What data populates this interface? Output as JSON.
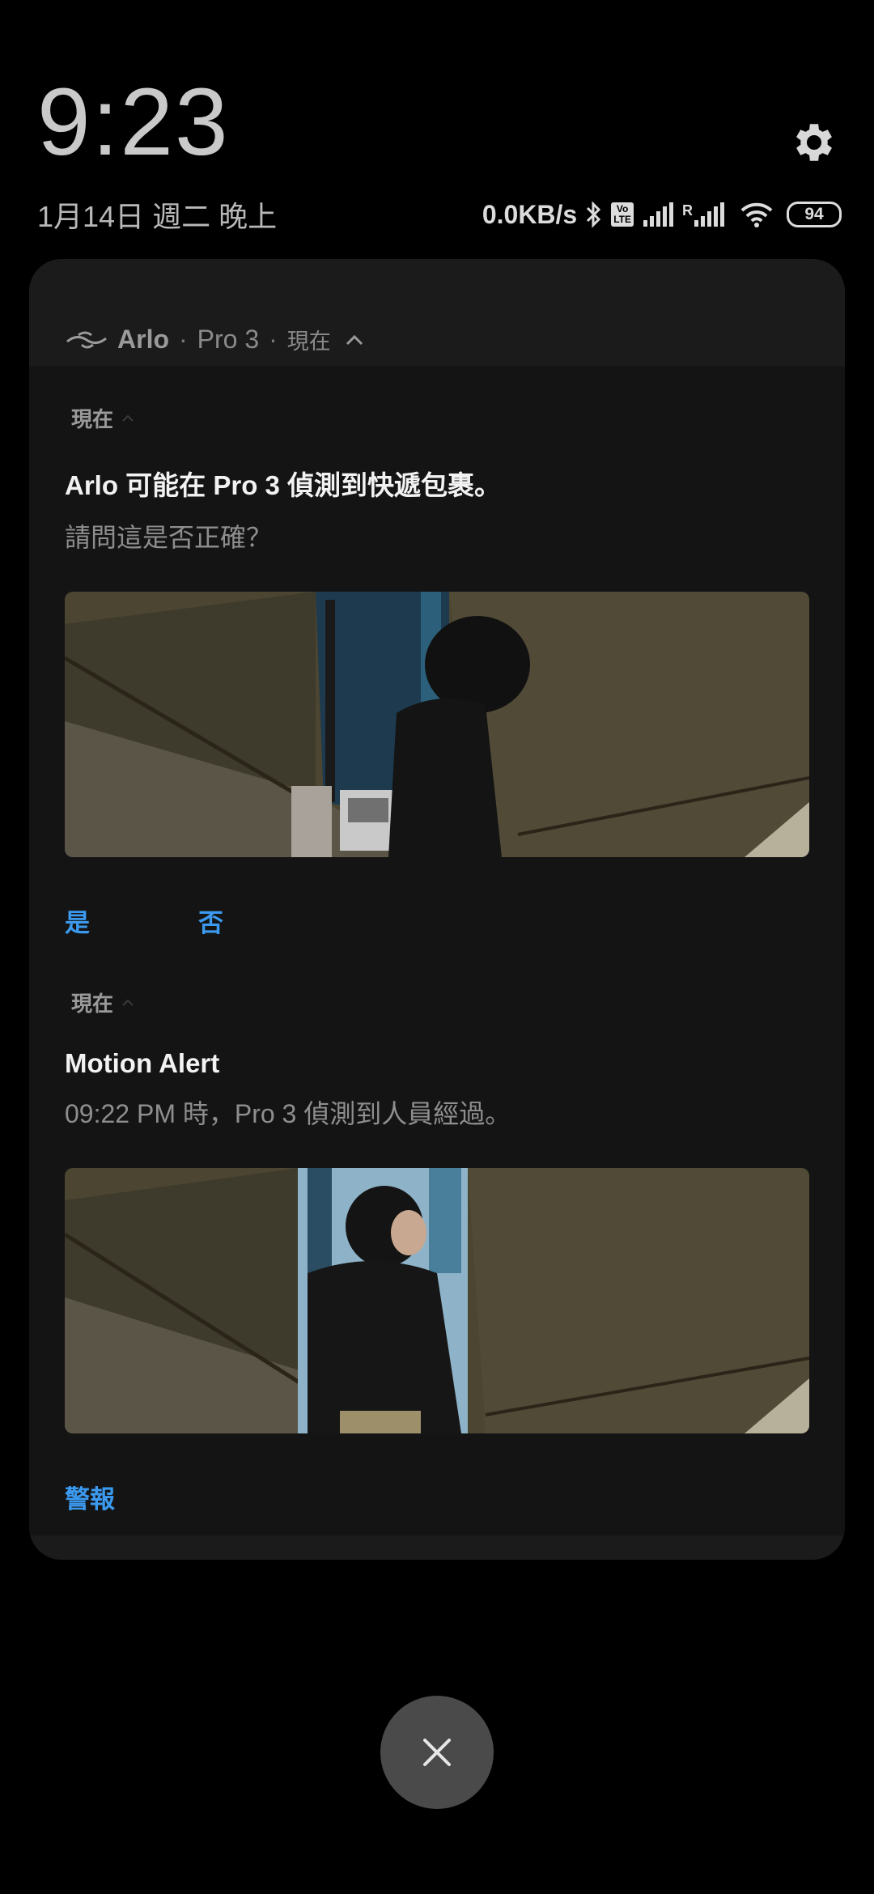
{
  "status": {
    "time": "9:23",
    "date": "1月14日 週二 晚上",
    "net_speed": "0.0KB/s",
    "volte": "Vo LTE",
    "roaming": "R",
    "battery": "94"
  },
  "group": {
    "app_name": "Arlo",
    "device": "Pro 3",
    "when": "現在",
    "separator": "·"
  },
  "notifications": [
    {
      "when": "現在",
      "title": "Arlo 可能在 Pro 3 偵測到快遞包裹。",
      "body": "請問這是否正確？",
      "actions": [
        "是",
        "否"
      ]
    },
    {
      "when": "現在",
      "title": "Motion Alert",
      "body": "09:22 PM 時，Pro 3 偵測到人員經過。",
      "actions": [
        "警報"
      ]
    }
  ],
  "colors": {
    "accent": "#3b9aef",
    "card": "#141414",
    "background": "#000000"
  },
  "icons": [
    "gear-icon",
    "bluetooth-icon",
    "signal-icon",
    "wifi-icon",
    "battery-icon",
    "arlo-logo-icon",
    "chevron-up-icon",
    "close-icon"
  ]
}
